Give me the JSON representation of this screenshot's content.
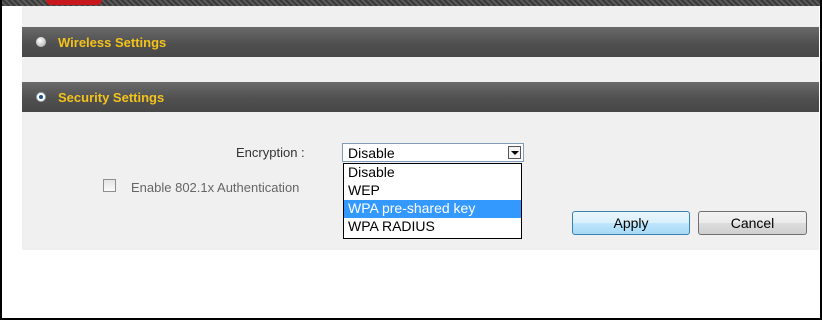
{
  "sections": {
    "wireless": {
      "title": "Wireless Settings"
    },
    "security": {
      "title": "Security Settings"
    }
  },
  "encryption": {
    "label": "Encryption :",
    "selected": "Disable",
    "options": [
      "Disable",
      "WEP",
      "WPA pre-shared key",
      "WPA RADIUS"
    ],
    "highlighted_option": "WPA pre-shared key"
  },
  "auth": {
    "label": "Enable 802.1x Authentication",
    "checked": false
  },
  "buttons": {
    "apply": "Apply",
    "cancel": "Cancel"
  },
  "colors": {
    "section_title": "#f3c21b",
    "highlight": "#3399ff"
  },
  "icons": {
    "section_toggle": "radio-button-icon",
    "dropdown": "chevron-down-icon"
  }
}
